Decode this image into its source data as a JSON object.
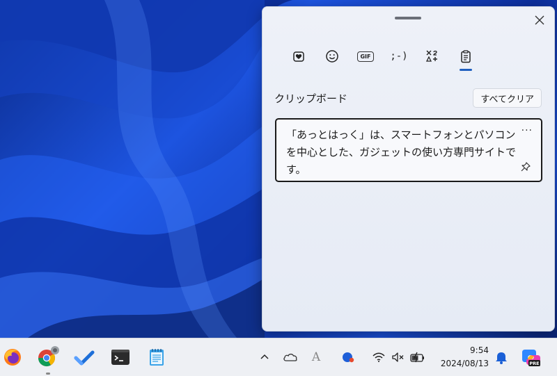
{
  "panel": {
    "tabs": [
      {
        "name": "favorites",
        "glyph": ""
      },
      {
        "name": "emoji",
        "glyph": ""
      },
      {
        "name": "gif",
        "glyph": "GIF"
      },
      {
        "name": "kaomoji",
        "glyph": ";-)"
      },
      {
        "name": "symbols",
        "glyph": ""
      },
      {
        "name": "clipboard",
        "glyph": ""
      }
    ],
    "active_tab": "clipboard",
    "section_title": "クリップボード",
    "clear_all_label": "すべてクリア",
    "clip_items": [
      {
        "text": "「あっとはっく」は、スマートフォンとパソコンを中心とした、ガジェットの使い方専門サイトです。",
        "more": "···"
      }
    ]
  },
  "taskbar": {
    "time": "9:54",
    "date": "2024/08/13",
    "font_tray_label": "A"
  },
  "colors": {
    "accent": "#1f5fbf",
    "panel_bg": "#eef1f8",
    "taskbar_bg": "#eef0f4"
  }
}
